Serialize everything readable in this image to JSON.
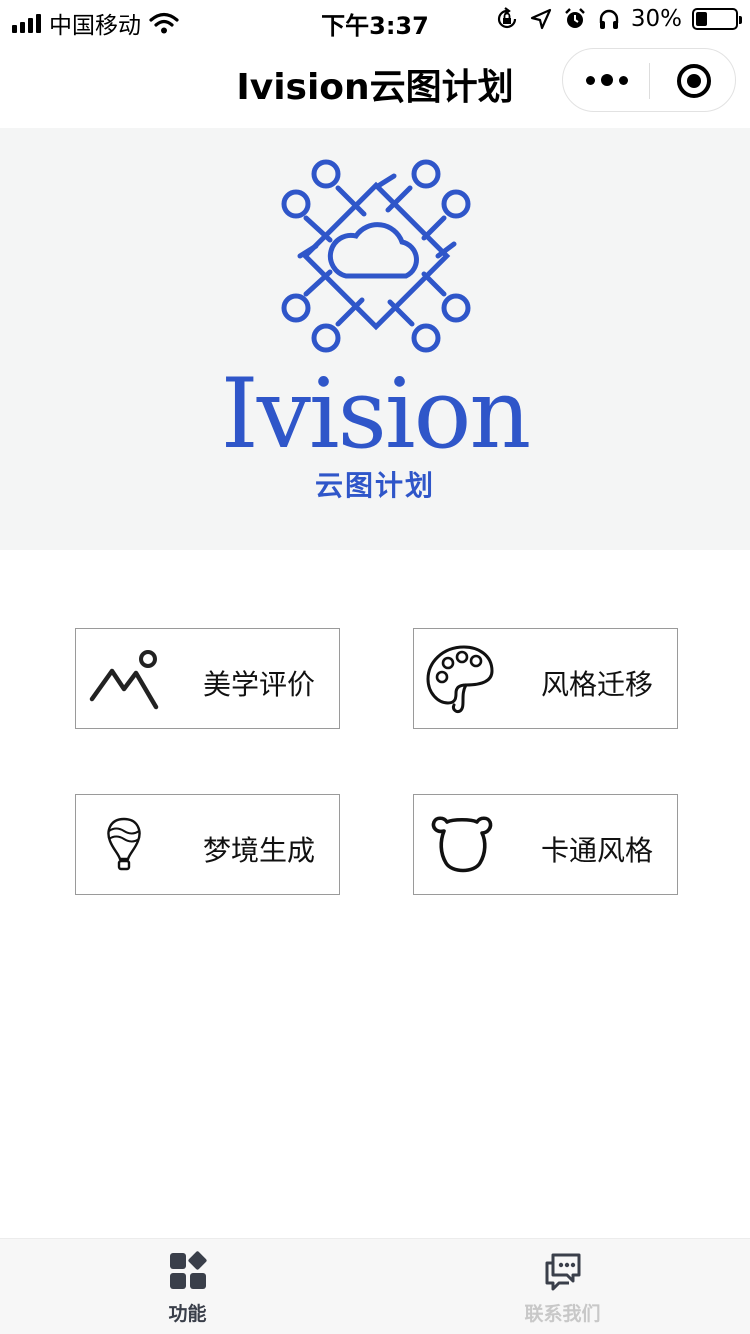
{
  "status_bar": {
    "carrier": "中国移动",
    "time": "下午3:37",
    "battery_text": "30%",
    "battery_level": 0.3,
    "icons": [
      "signal-icon",
      "wifi-icon",
      "rotation-lock-icon",
      "location-icon",
      "alarm-icon",
      "headphones-icon",
      "battery-icon"
    ]
  },
  "nav": {
    "title": "Ivision云图计划",
    "capsule_icons": [
      "more-icon",
      "close-miniprogram-icon"
    ]
  },
  "banner": {
    "logo_word": "Ivision",
    "logo_sub": "云图计划",
    "brand_color": "#2f56c9"
  },
  "features": [
    {
      "label": "美学评价",
      "icon": "mountain-icon"
    },
    {
      "label": "风格迁移",
      "icon": "palette-icon"
    },
    {
      "label": "梦境生成",
      "icon": "hot-air-balloon-icon"
    },
    {
      "label": "卡通风格",
      "icon": "bear-face-icon"
    }
  ],
  "tabs": [
    {
      "label": "功能",
      "icon": "apps-grid-icon",
      "active": true,
      "color": "#3a3f4a"
    },
    {
      "label": "联系我们",
      "icon": "chat-icon",
      "active": false,
      "color": "#c8c8c8"
    }
  ]
}
